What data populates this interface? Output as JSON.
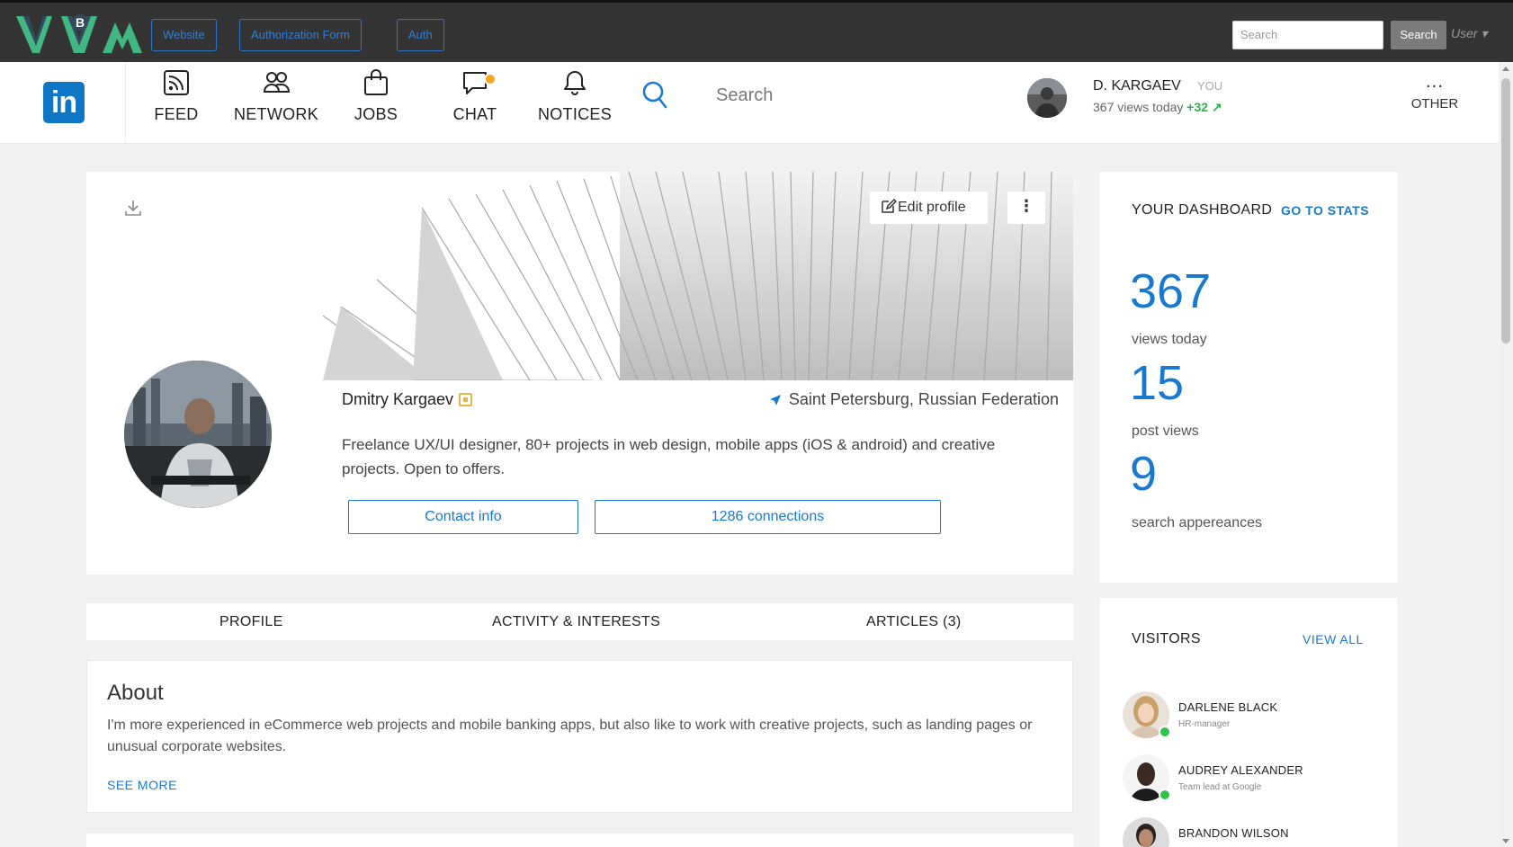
{
  "topbar": {
    "buttons": [
      "Website",
      "Authorization Form",
      "Auth"
    ],
    "search_placeholder": "Search",
    "search_button": "Search",
    "user_menu": "User"
  },
  "navbar": {
    "logo": "in",
    "items": [
      {
        "label": "FEED",
        "icon": "rss-icon"
      },
      {
        "label": "NETWORK",
        "icon": "people-icon"
      },
      {
        "label": "JOBS",
        "icon": "bag-icon"
      },
      {
        "label": "CHAT",
        "icon": "chat-icon"
      },
      {
        "label": "NOTICES",
        "icon": "bell-icon"
      }
    ],
    "search_placeholder": "Search",
    "user": {
      "name": "D. KARGAEV",
      "you": "YOU",
      "views_text": "367 views today",
      "delta": "+32"
    },
    "other": {
      "dots": "...",
      "label": "OTHER"
    }
  },
  "profile": {
    "edit_button": "Edit profile",
    "kebab": "⋮",
    "name": "Dmitry Kargaev",
    "location": "Saint Petersburg, Russian Federation",
    "bio": "Freelance UX/UI designer, 80+ projects in web design, mobile apps (iOS & android) and creative projects. Open to offers.",
    "contact_button": "Contact info",
    "connections_button": "1286 connections"
  },
  "tabs": [
    "PROFILE",
    "ACTIVITY & INTERESTS",
    "ARTICLES (3)"
  ],
  "about": {
    "title": "About",
    "text": "I'm more experienced in eCommerce web projects and mobile banking apps, but also like to work with creative projects, such as landing pages or unusual corporate websites.",
    "see_more": "SEE MORE"
  },
  "dashboard": {
    "title": "YOUR DASHBOARD",
    "link": "GO TO STATS",
    "stats": [
      {
        "value": "367",
        "label": "views today"
      },
      {
        "value": "15",
        "label": "post views"
      },
      {
        "value": "9",
        "label": "search appereances"
      }
    ]
  },
  "visitors": {
    "title": "VISITORS",
    "link": "VIEW ALL",
    "list": [
      {
        "name": "DARLENE BLACK",
        "role": "HR-manager"
      },
      {
        "name": "AUDREY ALEXANDER",
        "role": "Team lead at Google"
      },
      {
        "name": "BRANDON WILSON",
        "role": ""
      }
    ]
  },
  "colors": {
    "accent": "#1979d0",
    "topbar": "#343434",
    "online": "#2ec44a",
    "positive": "#2bb24c",
    "chat_badge": "#f5a623"
  }
}
